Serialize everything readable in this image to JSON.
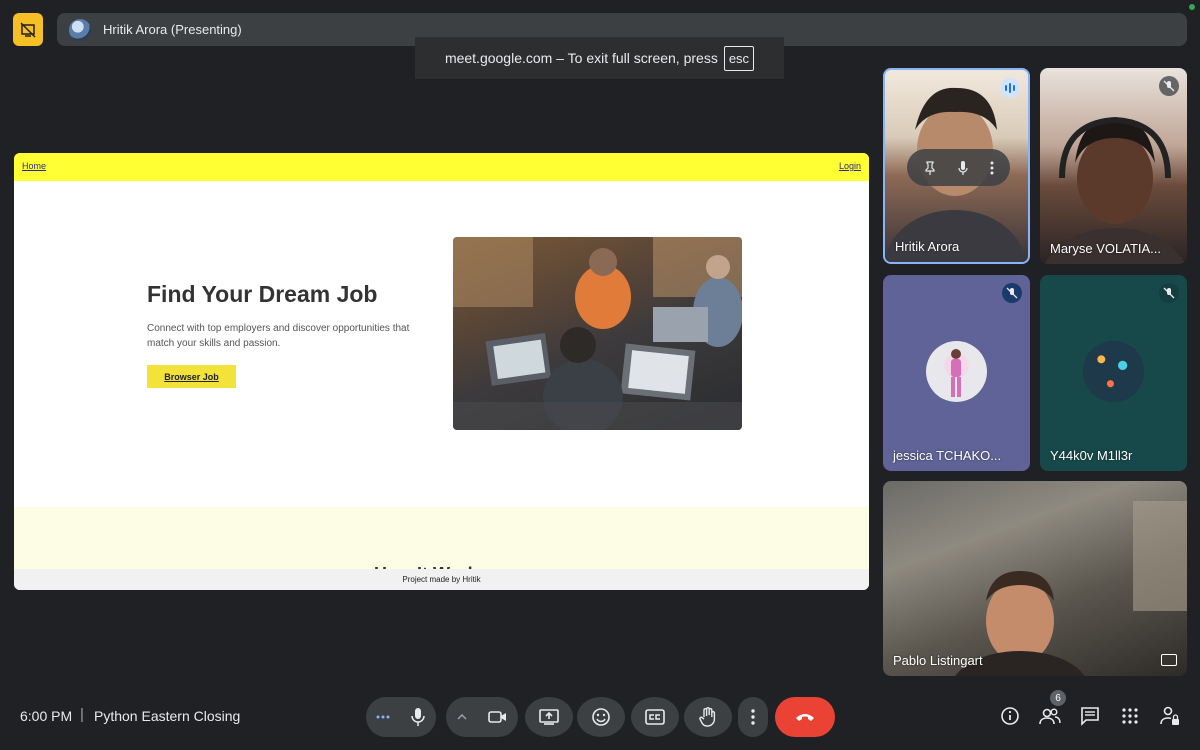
{
  "top_bar": {
    "presenter_label": "Hritik Arora (Presenting)"
  },
  "fullscreen_toast": {
    "message": "meet.google.com – To exit full screen, press",
    "key": "esc"
  },
  "shared_screen": {
    "nav": {
      "home": "Home",
      "login": "Login"
    },
    "hero": {
      "title": "Find Your Dream Job",
      "description": "Connect with top employers and discover opportunities that match your skills and passion.",
      "button": "Browser Job"
    },
    "next_section_peek": "How It Works",
    "footer": "Project made by Hritik"
  },
  "participants": [
    {
      "name": "Hritik Arora",
      "status": "speaking"
    },
    {
      "name": "Maryse VOLATIA...",
      "status": "muted"
    },
    {
      "name": "jessica TCHAKO...",
      "status": "muted"
    },
    {
      "name": "Y44k0v M1ll3r",
      "status": "muted"
    },
    {
      "name": "Pablo Listingart",
      "status": "unmuted"
    }
  ],
  "bottom_bar": {
    "time": "6:00 PM",
    "separator": "|",
    "meeting_title": "Python Eastern Closing",
    "people_count": "6"
  },
  "colors": {
    "background": "#202124",
    "accent_yellow": "#f6bf26",
    "leave_red": "#ea4335",
    "speaking_blue": "#8ab4f8",
    "site_nav_yellow": "#ffff33"
  }
}
